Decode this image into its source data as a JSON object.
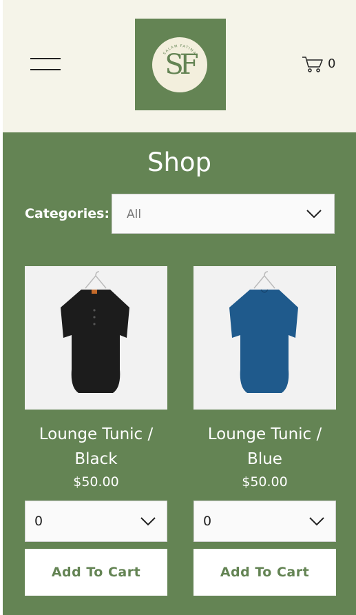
{
  "header": {
    "logo_text": "SF",
    "logo_arc_text": "SALAM FATIMA",
    "cart_count": "0"
  },
  "shop": {
    "title": "Shop",
    "categories_label": "Categories:",
    "categories_selected": "All"
  },
  "products": [
    {
      "name_line1": "Lounge Tunic /",
      "name_line2": "Black",
      "price": "$50.00",
      "quantity": "0",
      "add_to_cart": "Add To Cart",
      "color": "#1c1c1c"
    },
    {
      "name_line1": "Lounge Tunic /",
      "name_line2": "Blue",
      "price": "$50.00",
      "quantity": "0",
      "add_to_cart": "Add To Cart",
      "color": "#1f5a8c"
    }
  ],
  "colors": {
    "brand_green": "#648454",
    "header_bg": "#f5f4e9",
    "logo_cream": "#f3efdd"
  }
}
